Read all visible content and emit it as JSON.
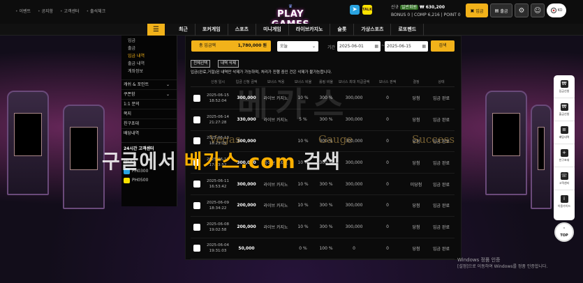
{
  "top_links": [
    "이벤트",
    "공지함",
    "고객센터",
    "출석체크"
  ],
  "logo": {
    "text": "PLAY GAMES"
  },
  "social": {
    "telegram": "telegram-icon",
    "kakao": "TALK"
  },
  "user": {
    "name": "신규",
    "level_badge": "일반회원",
    "money": "₩ 630,200",
    "bonus": "BONUS 0",
    "comp": "COMP 6,216",
    "point": "POINT 0"
  },
  "header_buttons": {
    "deposit": "입금",
    "withdraw": "출금",
    "lang": "KO"
  },
  "nav": {
    "items": [
      "최근",
      "포커게임",
      "스포츠",
      "미니게임",
      "라이브카지노",
      "슬롯",
      "가상스포츠",
      "로또펜드"
    ]
  },
  "sidemenu": {
    "sub_items": [
      "입금",
      "출금",
      "입금 내역",
      "출금 내역",
      "계좌정보"
    ],
    "active_index": 2,
    "sections": [
      "캐쉬 & 포인트",
      "쿠폰함",
      "1:1 문의",
      "쪽지",
      "친구초대",
      "배당내역"
    ],
    "support": {
      "title": "24시간 고객센터",
      "desc": "합니다.",
      "contacts": [
        "PH0300",
        "PH0500"
      ]
    }
  },
  "filters": {
    "total_label": "총 입금액",
    "total_value": "1,780,000 원",
    "period_select": "오늘",
    "period_label": "기간",
    "date_from": "2025-06-01",
    "date_to": "2025-06-15",
    "search": "검색"
  },
  "actions": {
    "select_all": "전체선택",
    "delete": "내역 삭제"
  },
  "notice": "입금(완료,거절)된 내역만 삭제가 가능하며, 처리가 진행 중인 건은 삭제가 불가능합니다.",
  "table": {
    "headers": [
      "",
      "신청 일시",
      "입금 신청 금액",
      "보너스 적용",
      "보너스 비율",
      "롤링 비율",
      "보너스 최대 지급금액",
      "보너스 판액",
      "결정",
      "상태"
    ],
    "rows": [
      [
        "2025-06-15\n18:52:04",
        "300,000",
        "라이브 카지노",
        "10 %",
        "300 %",
        "300,000",
        "0",
        "당첨",
        "입금 완료"
      ],
      [
        "2025-06-14\n21:27:28",
        "330,000",
        "라이브 카지노",
        "5 %",
        "300 %",
        "300,000",
        "0",
        "당첨",
        "입금 완료"
      ],
      [
        "2025-06-13\n18:23:09",
        "300,000",
        "",
        "10 %",
        "300 %",
        "300,000",
        "0",
        "당첨",
        "입금 완료"
      ],
      [
        "2025-06-12\n17:53:52",
        "300,000",
        "라이브 카지노",
        "10 %",
        "300 %",
        "300,000",
        "0",
        "당첨",
        "입금 완료"
      ],
      [
        "2025-06-11\n16:53:42",
        "300,000",
        "라이브 카지노",
        "10 %",
        "300 %",
        "300,000",
        "0",
        "미당첨",
        "입금 완료"
      ],
      [
        "2025-06-09\n18:34:22",
        "200,000",
        "라이브 카지노",
        "10 %",
        "300 %",
        "300,000",
        "0",
        "당첨",
        "입금 완료"
      ],
      [
        "2025-06-08\n19:02:58",
        "200,000",
        "라이브 카지노",
        "10 %",
        "300 %",
        "300,000",
        "0",
        "당첨",
        "입금 완료"
      ],
      [
        "2025-06-04\n19:31:03",
        "50,000",
        "",
        "0 %",
        "100 %",
        "0",
        "0",
        "당첨",
        "입금 완료"
      ]
    ]
  },
  "right_bar": {
    "items": [
      "입금신청",
      "출금신청",
      "배팅내역",
      "친구초대",
      "고객센터",
      "이용가이드"
    ],
    "top": "TOP"
  },
  "watermark": {
    "main_prefix": "구글에서 ",
    "main_highlight": "베가스.com",
    "main_suffix": " 검색",
    "faint": "베가스",
    "words": [
      "Vegas",
      "Gauge",
      "Success"
    ]
  },
  "windows_activation": {
    "title": "Windows 정품 인증",
    "desc": "[설정]으로 이동하여 Windows를 정품 인증합니다."
  }
}
